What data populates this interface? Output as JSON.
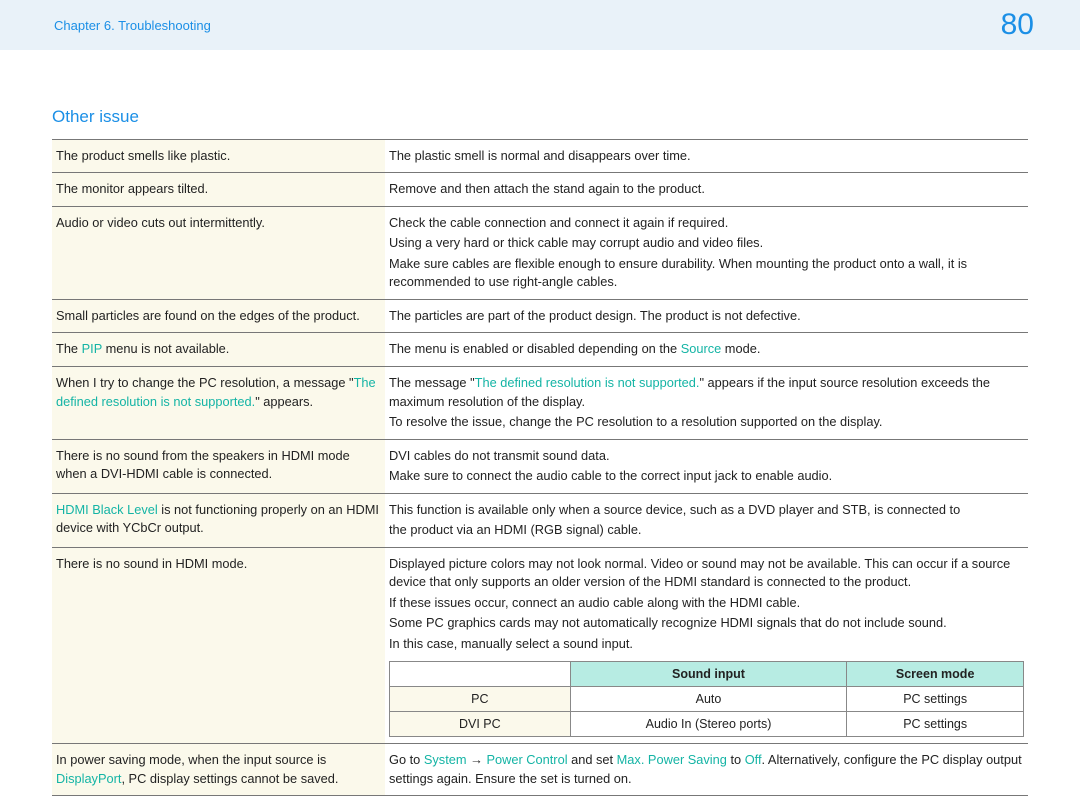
{
  "header": {
    "chapter": "Chapter 6. Troubleshooting",
    "page": "80"
  },
  "section_title": "Other issue",
  "rows": [
    {
      "left": [
        {
          "type": "text",
          "text": "The product smells like plastic."
        }
      ],
      "right": [
        {
          "type": "text",
          "text": "The plastic smell is normal and disappears over time."
        }
      ]
    },
    {
      "left": [
        {
          "type": "text",
          "text": "The monitor appears tilted."
        }
      ],
      "right": [
        {
          "type": "text",
          "text": "Remove and then attach the stand again to the product."
        }
      ]
    },
    {
      "left": [
        {
          "type": "text",
          "text": "Audio or video cuts out intermittently."
        }
      ],
      "right": [
        {
          "type": "text",
          "text": "Check the cable connection and connect it again if required."
        },
        {
          "type": "text",
          "text": "Using a very hard or thick cable may corrupt audio and video files."
        },
        {
          "type": "text",
          "text": "Make sure cables are flexible enough to ensure durability. When mounting the product onto a wall, it is recommended to use right-angle cables."
        }
      ]
    },
    {
      "left": [
        {
          "type": "text",
          "text": "Small particles are found on the edges of the product."
        }
      ],
      "right": [
        {
          "type": "text",
          "text": "The particles are part of the product design. The product is not defective."
        }
      ]
    },
    {
      "left": [
        {
          "type": "mixed",
          "parts": [
            {
              "t": "The "
            },
            {
              "t": "PIP",
              "hl": true
            },
            {
              "t": " menu is not available."
            }
          ]
        }
      ],
      "right": [
        {
          "type": "mixed",
          "parts": [
            {
              "t": "The menu is enabled or disabled depending on the "
            },
            {
              "t": "Source",
              "hl": true
            },
            {
              "t": " mode."
            }
          ]
        }
      ]
    },
    {
      "left": [
        {
          "type": "mixed",
          "parts": [
            {
              "t": "When I try to change the PC resolution, a message \""
            },
            {
              "t": "The defined resolution is not supported.",
              "hl": true
            },
            {
              "t": "\" appears."
            }
          ]
        }
      ],
      "right": [
        {
          "type": "mixed",
          "parts": [
            {
              "t": "The message \""
            },
            {
              "t": "The defined resolution is not supported.",
              "hl": true
            },
            {
              "t": "\" appears if the input source resolution exceeds the maximum resolution of the display."
            }
          ]
        },
        {
          "type": "text",
          "text": "To resolve the issue, change the PC resolution to a resolution supported on the display."
        }
      ]
    },
    {
      "left": [
        {
          "type": "text",
          "text": "There is no sound from the speakers in HDMI mode when a DVI-HDMI cable is connected."
        }
      ],
      "right": [
        {
          "type": "text",
          "text": "DVI cables do not transmit sound data."
        },
        {
          "type": "text",
          "text": "Make sure to connect the audio cable to the correct input jack to enable audio."
        }
      ]
    },
    {
      "left": [
        {
          "type": "mixed",
          "parts": [
            {
              "t": "HDMI Black Level",
              "hl": true
            },
            {
              "t": " is not functioning properly on an HDMI device with YCbCr output."
            }
          ]
        }
      ],
      "right": [
        {
          "type": "text",
          "text": "This function is available only when a source device, such as a DVD player and STB, is connected to"
        },
        {
          "type": "text",
          "text": "the product via an HDMI (RGB signal) cable."
        }
      ]
    },
    {
      "left": [
        {
          "type": "text",
          "text": "There is no sound in HDMI mode."
        }
      ],
      "right": [
        {
          "type": "text",
          "text": "Displayed picture colors may not look normal. Video or sound may not be available. This can occur if a source device that only supports an older version of the HDMI standard is connected to the product."
        },
        {
          "type": "text",
          "text": "If these issues occur, connect an audio cable along with the HDMI cable."
        },
        {
          "type": "text",
          "text": "Some PC graphics cards may not automatically recognize HDMI signals that do not include sound."
        },
        {
          "type": "text",
          "text": "In this case, manually select a sound input."
        },
        {
          "type": "table",
          "header": [
            "",
            "Sound input",
            "Screen mode"
          ],
          "rows": [
            [
              "PC",
              "Auto",
              "PC settings"
            ],
            [
              "DVI PC",
              "Audio In (Stereo ports)",
              "PC settings"
            ]
          ]
        }
      ]
    },
    {
      "left": [
        {
          "type": "mixed",
          "parts": [
            {
              "t": "In power saving mode, when the input source is "
            },
            {
              "t": "DisplayPort",
              "hl": true
            },
            {
              "t": ", PC display settings cannot be saved."
            }
          ]
        }
      ],
      "right": [
        {
          "type": "mixed",
          "parts": [
            {
              "t": "Go to "
            },
            {
              "t": "System",
              "hl": true
            },
            {
              "t": " → "
            },
            {
              "t": "Power Control",
              "hl": true
            },
            {
              "t": " and set "
            },
            {
              "t": "Max. Power Saving",
              "hl": true
            },
            {
              "t": " to "
            },
            {
              "t": "Off",
              "hl": true
            },
            {
              "t": ". Alternatively, configure the PC display output settings again. Ensure the set is turned on."
            }
          ]
        }
      ]
    }
  ]
}
